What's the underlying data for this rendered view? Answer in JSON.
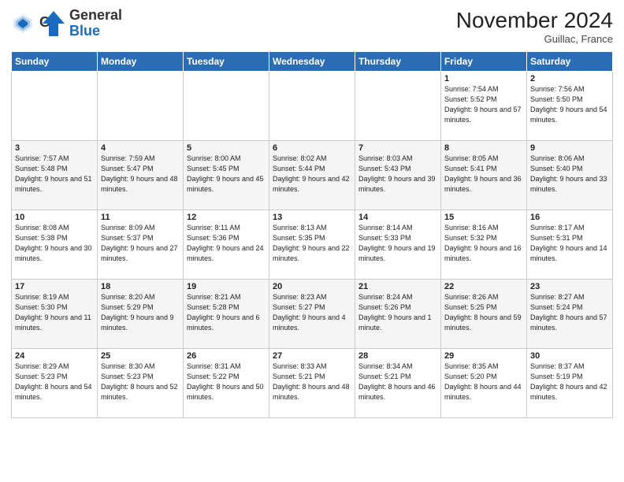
{
  "header": {
    "logo_general": "General",
    "logo_blue": "Blue",
    "month_title": "November 2024",
    "location": "Guillac, France"
  },
  "weekdays": [
    "Sunday",
    "Monday",
    "Tuesday",
    "Wednesday",
    "Thursday",
    "Friday",
    "Saturday"
  ],
  "weeks": [
    [
      {
        "day": "",
        "info": ""
      },
      {
        "day": "",
        "info": ""
      },
      {
        "day": "",
        "info": ""
      },
      {
        "day": "",
        "info": ""
      },
      {
        "day": "",
        "info": ""
      },
      {
        "day": "1",
        "info": "Sunrise: 7:54 AM\nSunset: 5:52 PM\nDaylight: 9 hours and 57 minutes."
      },
      {
        "day": "2",
        "info": "Sunrise: 7:56 AM\nSunset: 5:50 PM\nDaylight: 9 hours and 54 minutes."
      }
    ],
    [
      {
        "day": "3",
        "info": "Sunrise: 7:57 AM\nSunset: 5:48 PM\nDaylight: 9 hours and 51 minutes."
      },
      {
        "day": "4",
        "info": "Sunrise: 7:59 AM\nSunset: 5:47 PM\nDaylight: 9 hours and 48 minutes."
      },
      {
        "day": "5",
        "info": "Sunrise: 8:00 AM\nSunset: 5:45 PM\nDaylight: 9 hours and 45 minutes."
      },
      {
        "day": "6",
        "info": "Sunrise: 8:02 AM\nSunset: 5:44 PM\nDaylight: 9 hours and 42 minutes."
      },
      {
        "day": "7",
        "info": "Sunrise: 8:03 AM\nSunset: 5:43 PM\nDaylight: 9 hours and 39 minutes."
      },
      {
        "day": "8",
        "info": "Sunrise: 8:05 AM\nSunset: 5:41 PM\nDaylight: 9 hours and 36 minutes."
      },
      {
        "day": "9",
        "info": "Sunrise: 8:06 AM\nSunset: 5:40 PM\nDaylight: 9 hours and 33 minutes."
      }
    ],
    [
      {
        "day": "10",
        "info": "Sunrise: 8:08 AM\nSunset: 5:38 PM\nDaylight: 9 hours and 30 minutes."
      },
      {
        "day": "11",
        "info": "Sunrise: 8:09 AM\nSunset: 5:37 PM\nDaylight: 9 hours and 27 minutes."
      },
      {
        "day": "12",
        "info": "Sunrise: 8:11 AM\nSunset: 5:36 PM\nDaylight: 9 hours and 24 minutes."
      },
      {
        "day": "13",
        "info": "Sunrise: 8:13 AM\nSunset: 5:35 PM\nDaylight: 9 hours and 22 minutes."
      },
      {
        "day": "14",
        "info": "Sunrise: 8:14 AM\nSunset: 5:33 PM\nDaylight: 9 hours and 19 minutes."
      },
      {
        "day": "15",
        "info": "Sunrise: 8:16 AM\nSunset: 5:32 PM\nDaylight: 9 hours and 16 minutes."
      },
      {
        "day": "16",
        "info": "Sunrise: 8:17 AM\nSunset: 5:31 PM\nDaylight: 9 hours and 14 minutes."
      }
    ],
    [
      {
        "day": "17",
        "info": "Sunrise: 8:19 AM\nSunset: 5:30 PM\nDaylight: 9 hours and 11 minutes."
      },
      {
        "day": "18",
        "info": "Sunrise: 8:20 AM\nSunset: 5:29 PM\nDaylight: 9 hours and 9 minutes."
      },
      {
        "day": "19",
        "info": "Sunrise: 8:21 AM\nSunset: 5:28 PM\nDaylight: 9 hours and 6 minutes."
      },
      {
        "day": "20",
        "info": "Sunrise: 8:23 AM\nSunset: 5:27 PM\nDaylight: 9 hours and 4 minutes."
      },
      {
        "day": "21",
        "info": "Sunrise: 8:24 AM\nSunset: 5:26 PM\nDaylight: 9 hours and 1 minute."
      },
      {
        "day": "22",
        "info": "Sunrise: 8:26 AM\nSunset: 5:25 PM\nDaylight: 8 hours and 59 minutes."
      },
      {
        "day": "23",
        "info": "Sunrise: 8:27 AM\nSunset: 5:24 PM\nDaylight: 8 hours and 57 minutes."
      }
    ],
    [
      {
        "day": "24",
        "info": "Sunrise: 8:29 AM\nSunset: 5:23 PM\nDaylight: 8 hours and 54 minutes."
      },
      {
        "day": "25",
        "info": "Sunrise: 8:30 AM\nSunset: 5:23 PM\nDaylight: 8 hours and 52 minutes."
      },
      {
        "day": "26",
        "info": "Sunrise: 8:31 AM\nSunset: 5:22 PM\nDaylight: 8 hours and 50 minutes."
      },
      {
        "day": "27",
        "info": "Sunrise: 8:33 AM\nSunset: 5:21 PM\nDaylight: 8 hours and 48 minutes."
      },
      {
        "day": "28",
        "info": "Sunrise: 8:34 AM\nSunset: 5:21 PM\nDaylight: 8 hours and 46 minutes."
      },
      {
        "day": "29",
        "info": "Sunrise: 8:35 AM\nSunset: 5:20 PM\nDaylight: 8 hours and 44 minutes."
      },
      {
        "day": "30",
        "info": "Sunrise: 8:37 AM\nSunset: 5:19 PM\nDaylight: 8 hours and 42 minutes."
      }
    ]
  ]
}
